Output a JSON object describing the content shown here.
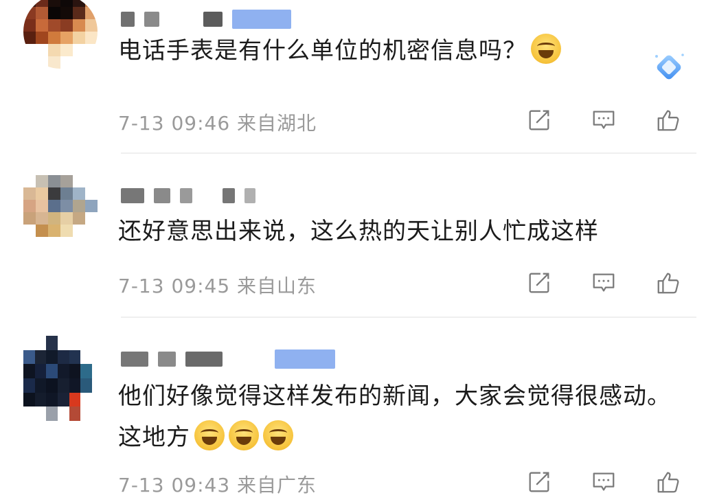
{
  "comments": [
    {
      "text": "电话手表是有什么单位的机密信息吗？",
      "time": "7-13 09:46",
      "location": "来自湖北",
      "emoji_count": 1,
      "icons": [
        "share-icon",
        "comment-icon",
        "like-icon"
      ]
    },
    {
      "text": "还好意思出来说，这么热的天让别人忙成这样",
      "time": "7-13 09:45",
      "location": "来自山东",
      "emoji_count": 0,
      "icons": [
        "share-icon",
        "comment-icon",
        "like-icon"
      ]
    },
    {
      "text": "他们好像觉得这样发布的新闻，大家会觉得很感动。这地方",
      "time": "7-13 09:43",
      "location": "来自广东",
      "emoji_count": 3,
      "icons": [
        "share-icon",
        "comment-icon",
        "like-icon"
      ]
    }
  ],
  "colors": {
    "text": "#1b1b1b",
    "meta": "#9a9a9a",
    "icon": "#7a7a7a",
    "divider": "#efefef"
  }
}
